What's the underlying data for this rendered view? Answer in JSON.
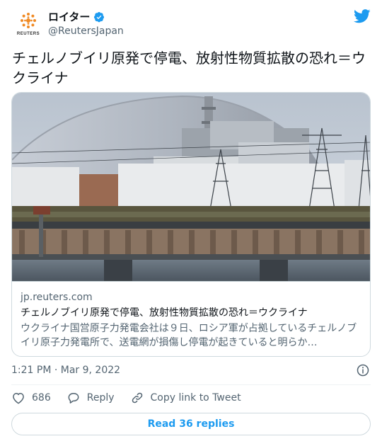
{
  "author": {
    "display_name": "ロイター",
    "handle": "@ReutersJapan",
    "avatar_text": "REUTERS",
    "verified": true
  },
  "tweet": {
    "text": "チェルノブイリ原発で停電、放射性物質拡散の恐れ＝ウクライナ",
    "timestamp": "1:21 PM · Mar 9, 2022"
  },
  "card": {
    "domain": "jp.reuters.com",
    "title": "チェルノブイリ原発で停電、放射性物質拡散の恐れ＝ウクライナ",
    "description": "ウクライナ国営原子力発電会社は９日、ロシア軍が占拠しているチェルノブイリ原子力発電所で、送電網が損傷し停電が起きていると明らか…"
  },
  "actions": {
    "like_count": "686",
    "reply_label": "Reply",
    "copy_link_label": "Copy link to Tweet"
  },
  "read_replies_label": "Read 36 replies",
  "icons": {
    "twitter": "twitter-bird-icon",
    "verified": "verified-badge-icon",
    "info": "info-icon",
    "like": "heart-icon",
    "reply": "reply-bubble-icon",
    "copy_link": "link-icon"
  },
  "colors": {
    "accent": "#1d9bf0",
    "text": "#0f1419",
    "secondary": "#536471",
    "border": "#cfd9de",
    "reuters_orange": "#f08a24"
  }
}
